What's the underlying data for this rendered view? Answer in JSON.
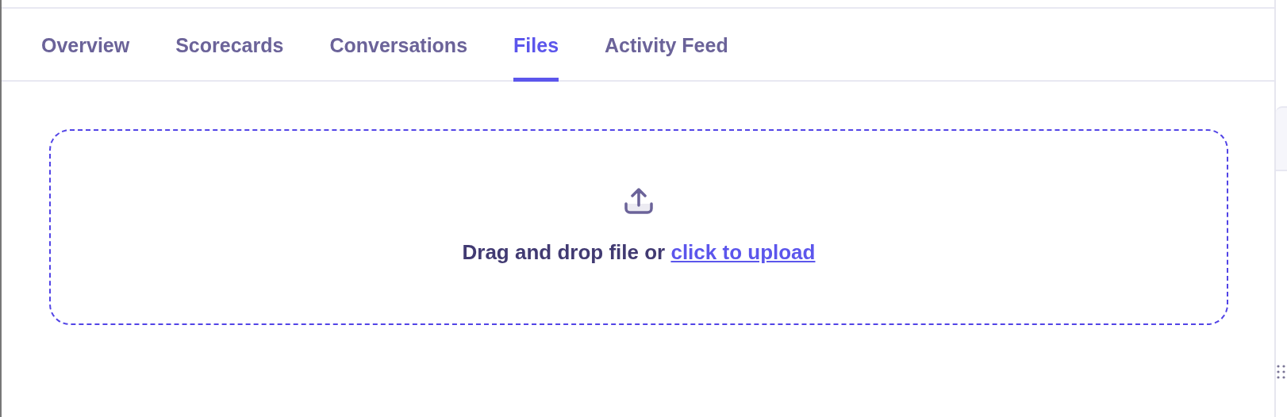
{
  "tabs": [
    {
      "label": "Overview",
      "selected": false
    },
    {
      "label": "Scorecards",
      "selected": false
    },
    {
      "label": "Conversations",
      "selected": false
    },
    {
      "label": "Files",
      "selected": true
    },
    {
      "label": "Activity Feed",
      "selected": false
    }
  ],
  "upload": {
    "prompt": "Drag and drop file or",
    "link": "click to upload"
  }
}
